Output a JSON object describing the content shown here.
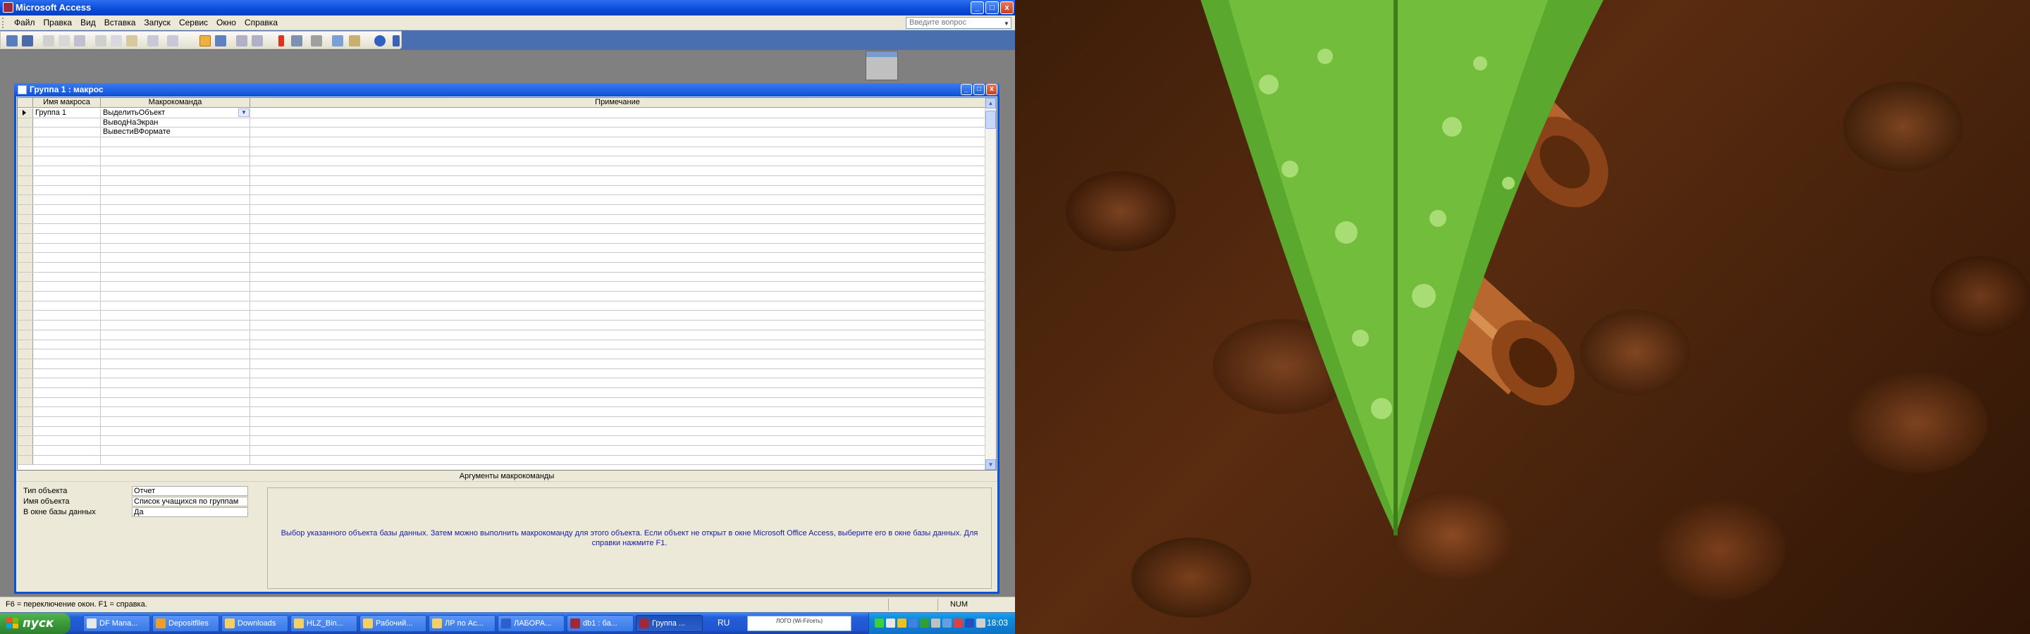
{
  "app": {
    "title": "Microsoft Access",
    "menu": [
      "Файл",
      "Правка",
      "Вид",
      "Вставка",
      "Запуск",
      "Сервис",
      "Окно",
      "Справка"
    ],
    "help_search_placeholder": "Введите вопрос",
    "window_buttons": {
      "minimize": "_",
      "maximize": "□",
      "close": "x"
    }
  },
  "macro_window": {
    "title": "Группа 1 : макрос",
    "columns": [
      "Имя макроса",
      "Макрокоманда",
      "Примечание"
    ],
    "rows": [
      {
        "name": "Группа 1",
        "action": "ВыделитьОбъект",
        "note": ""
      },
      {
        "name": "",
        "action": "ВыводНаЭкран",
        "note": ""
      },
      {
        "name": "",
        "action": "ВывестиВФормате",
        "note": ""
      }
    ],
    "empty_row_count": 34,
    "arguments_title": "Аргументы макрокоманды",
    "arguments": [
      {
        "label": "Тип объекта",
        "value": "Отчет"
      },
      {
        "label": "Имя объекта",
        "value": "Список учащихся по группам"
      },
      {
        "label": "В окне базы данных",
        "value": "Да"
      }
    ],
    "hint": "Выбор указанного объекта базы данных. Затем можно выполнить макрокоманду для этого объекта. Если объект не открыт в окне Microsoft Office Access, выберите его в окне базы данных. Для справки нажмите F1."
  },
  "status": {
    "text": "F6 = переключение окон.  F1 = справка.",
    "num": "NUM"
  },
  "taskbar": {
    "start_label": "пуск",
    "items": [
      {
        "label": "DF Mana...",
        "icon_color": "#e8e8e8",
        "active": false
      },
      {
        "label": "Depositfiles",
        "icon_color": "#f0a020",
        "active": false
      },
      {
        "label": "Downloads",
        "icon_color": "#f5d060",
        "active": false
      },
      {
        "label": "HLZ_Bin...",
        "icon_color": "#f5d060",
        "active": false
      },
      {
        "label": "Рабочий...",
        "icon_color": "#f5d060",
        "active": false
      },
      {
        "label": "ЛР по Ас...",
        "icon_color": "#f5d060",
        "active": false
      },
      {
        "label": "ЛАБОРА...",
        "icon_color": "#2f5fcc",
        "active": false
      },
      {
        "label": "db1 : ба...",
        "icon_color": "#a0283a",
        "active": false
      },
      {
        "label": "Группа ...",
        "icon_color": "#a0283a",
        "active": true
      }
    ],
    "language": "RU",
    "tray_app_text": "ЛОГО\n(Wi-Fi/сеть)",
    "clock": "18:03"
  },
  "colors": {
    "xp_blue": "#0a52d8",
    "hint_text": "#1a1aa8",
    "panel": "#ece9d8"
  }
}
